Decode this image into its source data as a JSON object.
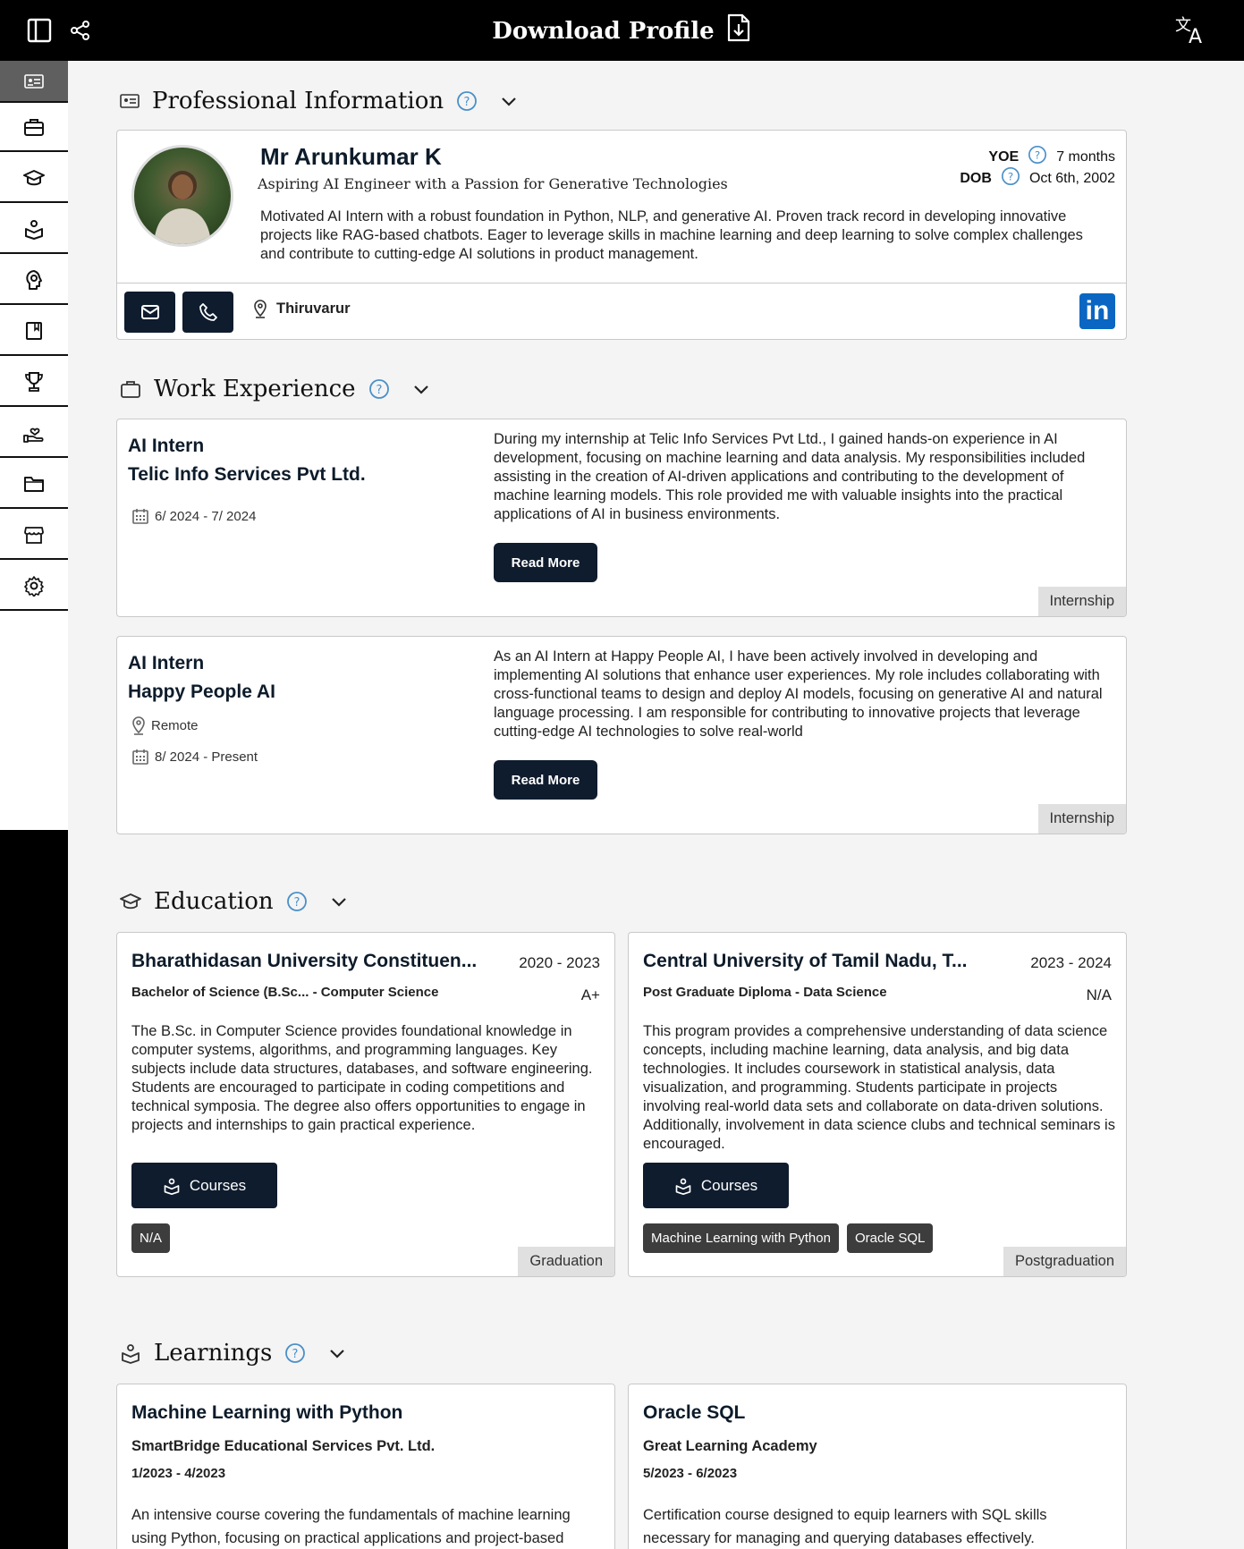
{
  "topbar": {
    "title": "Download Profile",
    "icons": [
      "sidebar-toggle-icon",
      "share-icon",
      "download-file-icon",
      "translate-icon"
    ]
  },
  "sidebar": {
    "items": [
      {
        "icon": "id-card-icon",
        "active": true
      },
      {
        "icon": "briefcase-icon"
      },
      {
        "icon": "graduation-cap-icon"
      },
      {
        "icon": "learning-box-icon"
      },
      {
        "icon": "brain-skills-icon"
      },
      {
        "icon": "notebook-icon"
      },
      {
        "icon": "trophy-icon"
      },
      {
        "icon": "hand-heart-icon"
      },
      {
        "icon": "folder-icon"
      },
      {
        "icon": "store-icon"
      },
      {
        "icon": "gear-icon"
      }
    ]
  },
  "profile": {
    "section_title": "Professional Information",
    "name": "Mr Arunkumar K",
    "tagline": "Aspiring AI Engineer with a Passion for Generative Technologies",
    "summary": "Motivated AI Intern with a robust foundation in Python, NLP, and generative AI. Proven track record in developing innovative projects like RAG-based chatbots. Eager to leverage skills in machine learning and deep learning to solve complex challenges and contribute to cutting-edge AI solutions in product management.",
    "yoe_label": "YOE",
    "yoe_value": "7 months",
    "dob_label": "DOB",
    "dob_value": "Oct 6th, 2002",
    "location": "Thiruvarur",
    "linkedin_label": "in"
  },
  "work": {
    "section_title": "Work Experience",
    "items": [
      {
        "role": "AI Intern",
        "company": "Telic Info Services Pvt Ltd.",
        "dates": "6/ 2024 - 7/ 2024",
        "description": "During my internship at Telic Info Services Pvt Ltd., I gained hands-on experience in AI development, focusing on machine learning and data analysis. My responsibilities included assisting in the creation of AI-driven applications and contributing to the development of machine learning models. This role provided me with valuable insights into the practical applications of AI in business environments.",
        "button": "Read More",
        "type": "Internship"
      },
      {
        "role": "AI Intern",
        "company": "Happy People AI",
        "location": "Remote",
        "dates": "8/ 2024 - Present",
        "description": "As an AI Intern at Happy People AI, I have been actively involved in developing and implementing AI solutions that enhance user experiences. My role includes collaborating with cross-functional teams to design and deploy AI models, focusing on generative AI and natural language processing. I am responsible for contributing to innovative projects that leverage cutting-edge AI technologies to solve real-world",
        "button": "Read More",
        "type": "Internship"
      }
    ]
  },
  "education": {
    "section_title": "Education",
    "items": [
      {
        "institution": "Bharathidasan University Constituen...",
        "years": "2020 - 2023",
        "degree": "Bachelor of Science (B.Sc... - Computer Science",
        "grade": "A+",
        "description": "The B.Sc. in Computer Science provides foundational knowledge in computer systems, algorithms, and programming languages. Key subjects include data structures, databases, and software engineering. Students are encouraged to participate in coding competitions and technical symposia. The degree also offers opportunities to engage in projects and internships to gain practical experience.",
        "courses_label": "Courses",
        "chips": [
          "N/A"
        ],
        "level": "Graduation"
      },
      {
        "institution": "Central University of Tamil Nadu, T...",
        "years": "2023 - 2024",
        "degree": "Post Graduate Diploma - Data Science",
        "grade": "N/A",
        "description": "This program provides a comprehensive understanding of data science concepts, including machine learning, data analysis, and big data technologies. It includes coursework in statistical analysis, data visualization, and programming. Students participate in projects involving real-world data sets and collaborate on data-driven solutions. Additionally, involvement in data science clubs and technical seminars is encouraged.",
        "courses_label": "Courses",
        "chips": [
          "Machine Learning with Python",
          "Oracle SQL"
        ],
        "level": "Postgraduation"
      }
    ]
  },
  "learnings": {
    "section_title": "Learnings",
    "items": [
      {
        "title": "Machine Learning with Python",
        "org": "SmartBridge Educational Services Pvt. Ltd.",
        "dates": "1/2023 - 4/2023",
        "description": "An intensive course covering the fundamentals of machine learning using Python, focusing on practical applications and project-based"
      },
      {
        "title": "Oracle SQL",
        "org": "Great Learning Academy",
        "dates": "5/2023 - 6/2023",
        "description": "Certification course designed to equip learners with SQL skills necessary for managing and querying databases effectively."
      }
    ]
  },
  "colors": {
    "accent_dark": "#0f1c2e",
    "help_blue": "#4a90c8",
    "linkedin": "#0a66c2",
    "badge_bg": "#e0e0e0",
    "chip_bg": "#3d3d3d"
  }
}
